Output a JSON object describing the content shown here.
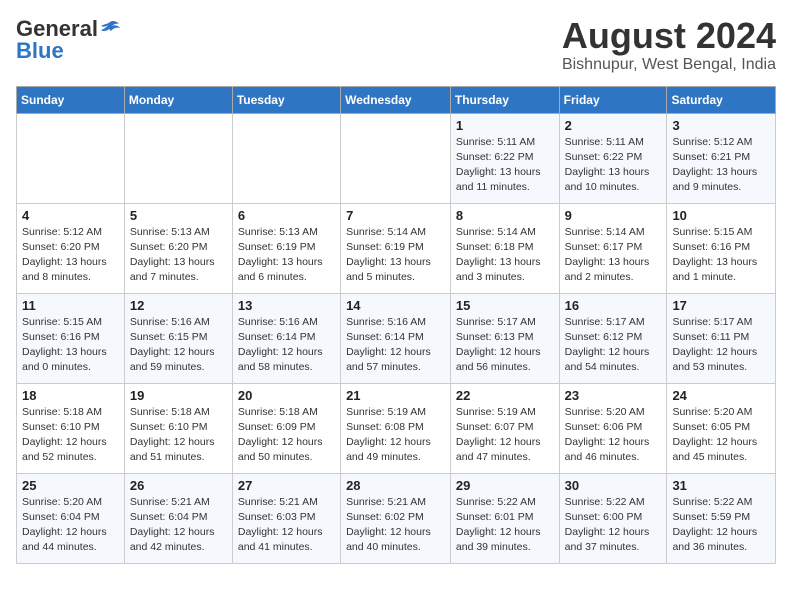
{
  "header": {
    "logo_general": "General",
    "logo_blue": "Blue",
    "title": "August 2024",
    "location": "Bishnupur, West Bengal, India"
  },
  "days_of_week": [
    "Sunday",
    "Monday",
    "Tuesday",
    "Wednesday",
    "Thursday",
    "Friday",
    "Saturday"
  ],
  "weeks": [
    [
      {
        "day": "",
        "info": ""
      },
      {
        "day": "",
        "info": ""
      },
      {
        "day": "",
        "info": ""
      },
      {
        "day": "",
        "info": ""
      },
      {
        "day": "1",
        "info": "Sunrise: 5:11 AM\nSunset: 6:22 PM\nDaylight: 13 hours\nand 11 minutes."
      },
      {
        "day": "2",
        "info": "Sunrise: 5:11 AM\nSunset: 6:22 PM\nDaylight: 13 hours\nand 10 minutes."
      },
      {
        "day": "3",
        "info": "Sunrise: 5:12 AM\nSunset: 6:21 PM\nDaylight: 13 hours\nand 9 minutes."
      }
    ],
    [
      {
        "day": "4",
        "info": "Sunrise: 5:12 AM\nSunset: 6:20 PM\nDaylight: 13 hours\nand 8 minutes."
      },
      {
        "day": "5",
        "info": "Sunrise: 5:13 AM\nSunset: 6:20 PM\nDaylight: 13 hours\nand 7 minutes."
      },
      {
        "day": "6",
        "info": "Sunrise: 5:13 AM\nSunset: 6:19 PM\nDaylight: 13 hours\nand 6 minutes."
      },
      {
        "day": "7",
        "info": "Sunrise: 5:14 AM\nSunset: 6:19 PM\nDaylight: 13 hours\nand 5 minutes."
      },
      {
        "day": "8",
        "info": "Sunrise: 5:14 AM\nSunset: 6:18 PM\nDaylight: 13 hours\nand 3 minutes."
      },
      {
        "day": "9",
        "info": "Sunrise: 5:14 AM\nSunset: 6:17 PM\nDaylight: 13 hours\nand 2 minutes."
      },
      {
        "day": "10",
        "info": "Sunrise: 5:15 AM\nSunset: 6:16 PM\nDaylight: 13 hours\nand 1 minute."
      }
    ],
    [
      {
        "day": "11",
        "info": "Sunrise: 5:15 AM\nSunset: 6:16 PM\nDaylight: 13 hours\nand 0 minutes."
      },
      {
        "day": "12",
        "info": "Sunrise: 5:16 AM\nSunset: 6:15 PM\nDaylight: 12 hours\nand 59 minutes."
      },
      {
        "day": "13",
        "info": "Sunrise: 5:16 AM\nSunset: 6:14 PM\nDaylight: 12 hours\nand 58 minutes."
      },
      {
        "day": "14",
        "info": "Sunrise: 5:16 AM\nSunset: 6:14 PM\nDaylight: 12 hours\nand 57 minutes."
      },
      {
        "day": "15",
        "info": "Sunrise: 5:17 AM\nSunset: 6:13 PM\nDaylight: 12 hours\nand 56 minutes."
      },
      {
        "day": "16",
        "info": "Sunrise: 5:17 AM\nSunset: 6:12 PM\nDaylight: 12 hours\nand 54 minutes."
      },
      {
        "day": "17",
        "info": "Sunrise: 5:17 AM\nSunset: 6:11 PM\nDaylight: 12 hours\nand 53 minutes."
      }
    ],
    [
      {
        "day": "18",
        "info": "Sunrise: 5:18 AM\nSunset: 6:10 PM\nDaylight: 12 hours\nand 52 minutes."
      },
      {
        "day": "19",
        "info": "Sunrise: 5:18 AM\nSunset: 6:10 PM\nDaylight: 12 hours\nand 51 minutes."
      },
      {
        "day": "20",
        "info": "Sunrise: 5:18 AM\nSunset: 6:09 PM\nDaylight: 12 hours\nand 50 minutes."
      },
      {
        "day": "21",
        "info": "Sunrise: 5:19 AM\nSunset: 6:08 PM\nDaylight: 12 hours\nand 49 minutes."
      },
      {
        "day": "22",
        "info": "Sunrise: 5:19 AM\nSunset: 6:07 PM\nDaylight: 12 hours\nand 47 minutes."
      },
      {
        "day": "23",
        "info": "Sunrise: 5:20 AM\nSunset: 6:06 PM\nDaylight: 12 hours\nand 46 minutes."
      },
      {
        "day": "24",
        "info": "Sunrise: 5:20 AM\nSunset: 6:05 PM\nDaylight: 12 hours\nand 45 minutes."
      }
    ],
    [
      {
        "day": "25",
        "info": "Sunrise: 5:20 AM\nSunset: 6:04 PM\nDaylight: 12 hours\nand 44 minutes."
      },
      {
        "day": "26",
        "info": "Sunrise: 5:21 AM\nSunset: 6:04 PM\nDaylight: 12 hours\nand 42 minutes."
      },
      {
        "day": "27",
        "info": "Sunrise: 5:21 AM\nSunset: 6:03 PM\nDaylight: 12 hours\nand 41 minutes."
      },
      {
        "day": "28",
        "info": "Sunrise: 5:21 AM\nSunset: 6:02 PM\nDaylight: 12 hours\nand 40 minutes."
      },
      {
        "day": "29",
        "info": "Sunrise: 5:22 AM\nSunset: 6:01 PM\nDaylight: 12 hours\nand 39 minutes."
      },
      {
        "day": "30",
        "info": "Sunrise: 5:22 AM\nSunset: 6:00 PM\nDaylight: 12 hours\nand 37 minutes."
      },
      {
        "day": "31",
        "info": "Sunrise: 5:22 AM\nSunset: 5:59 PM\nDaylight: 12 hours\nand 36 minutes."
      }
    ]
  ]
}
